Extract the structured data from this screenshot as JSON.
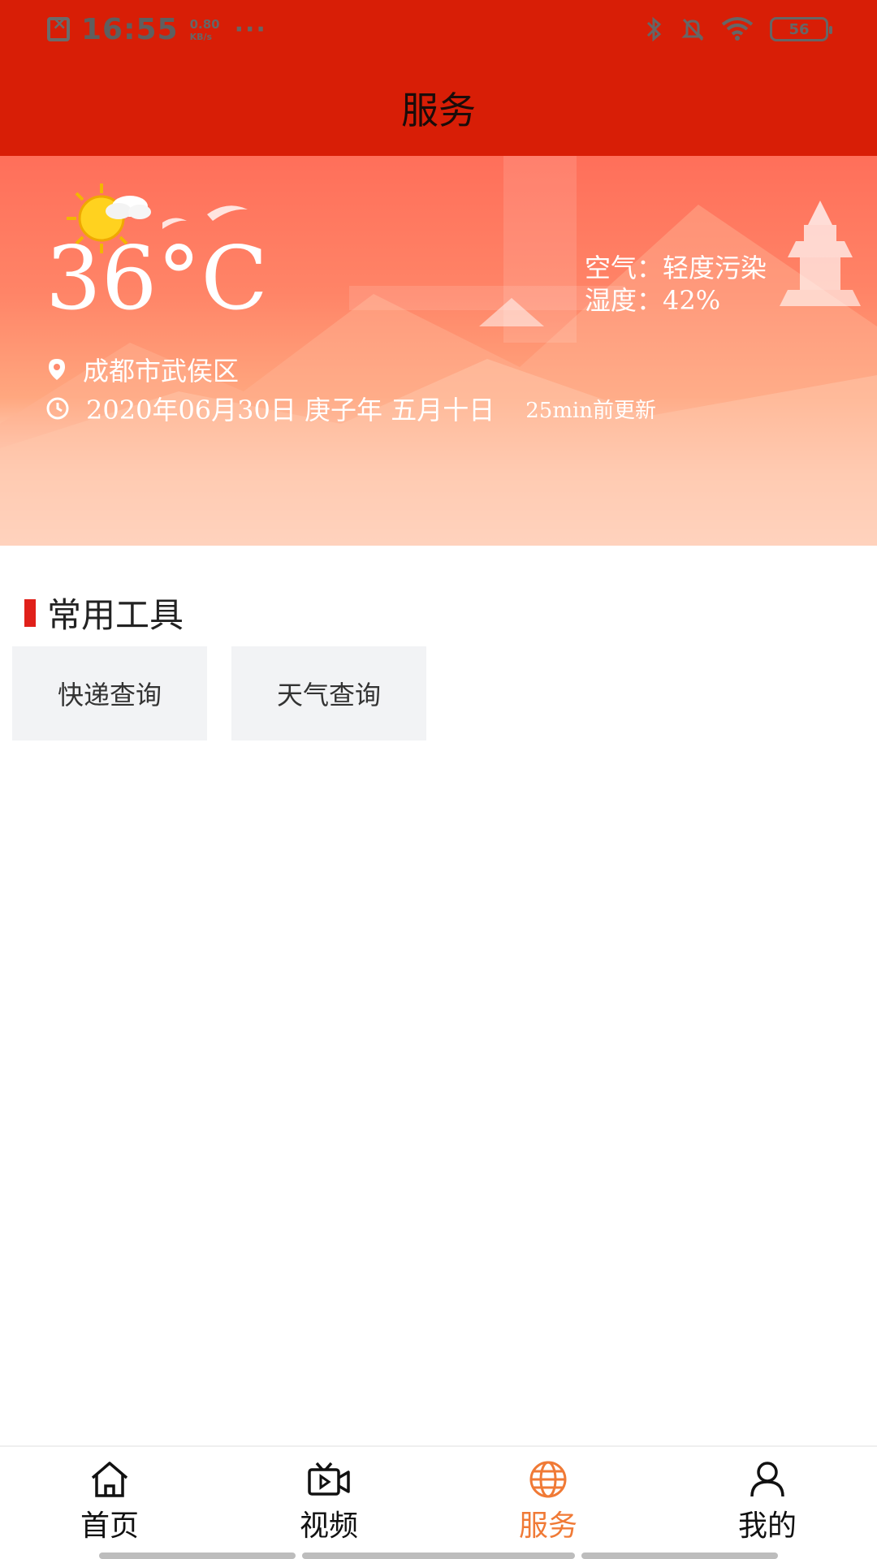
{
  "status_bar": {
    "time": "16:55",
    "net_speed_value": "0.80",
    "net_speed_unit": "KB/s",
    "more": "···",
    "battery": "56"
  },
  "header": {
    "title": "服务"
  },
  "weather": {
    "temperature": "36°C",
    "air_quality": "空气：轻度污染",
    "humidity": "湿度：42%",
    "location": "成都市武侯区",
    "date": "2020年06月30日 庚子年 五月十日",
    "updated": "25min前更新",
    "icon": "sun-cloud-icon"
  },
  "tools_section": {
    "title": "常用工具",
    "items": [
      {
        "label": "快递查询"
      },
      {
        "label": "天气查询"
      }
    ]
  },
  "bottom_nav": {
    "active": "服务",
    "active_color": "#f07a36",
    "items": [
      {
        "label": "首页",
        "icon": "home-icon"
      },
      {
        "label": "视频",
        "icon": "video-icon"
      },
      {
        "label": "服务",
        "icon": "globe-icon"
      },
      {
        "label": "我的",
        "icon": "user-icon"
      }
    ]
  },
  "colors": {
    "header_bg": "#d81e06",
    "accent": "#e0201a",
    "tool_bg": "#f2f3f5"
  }
}
